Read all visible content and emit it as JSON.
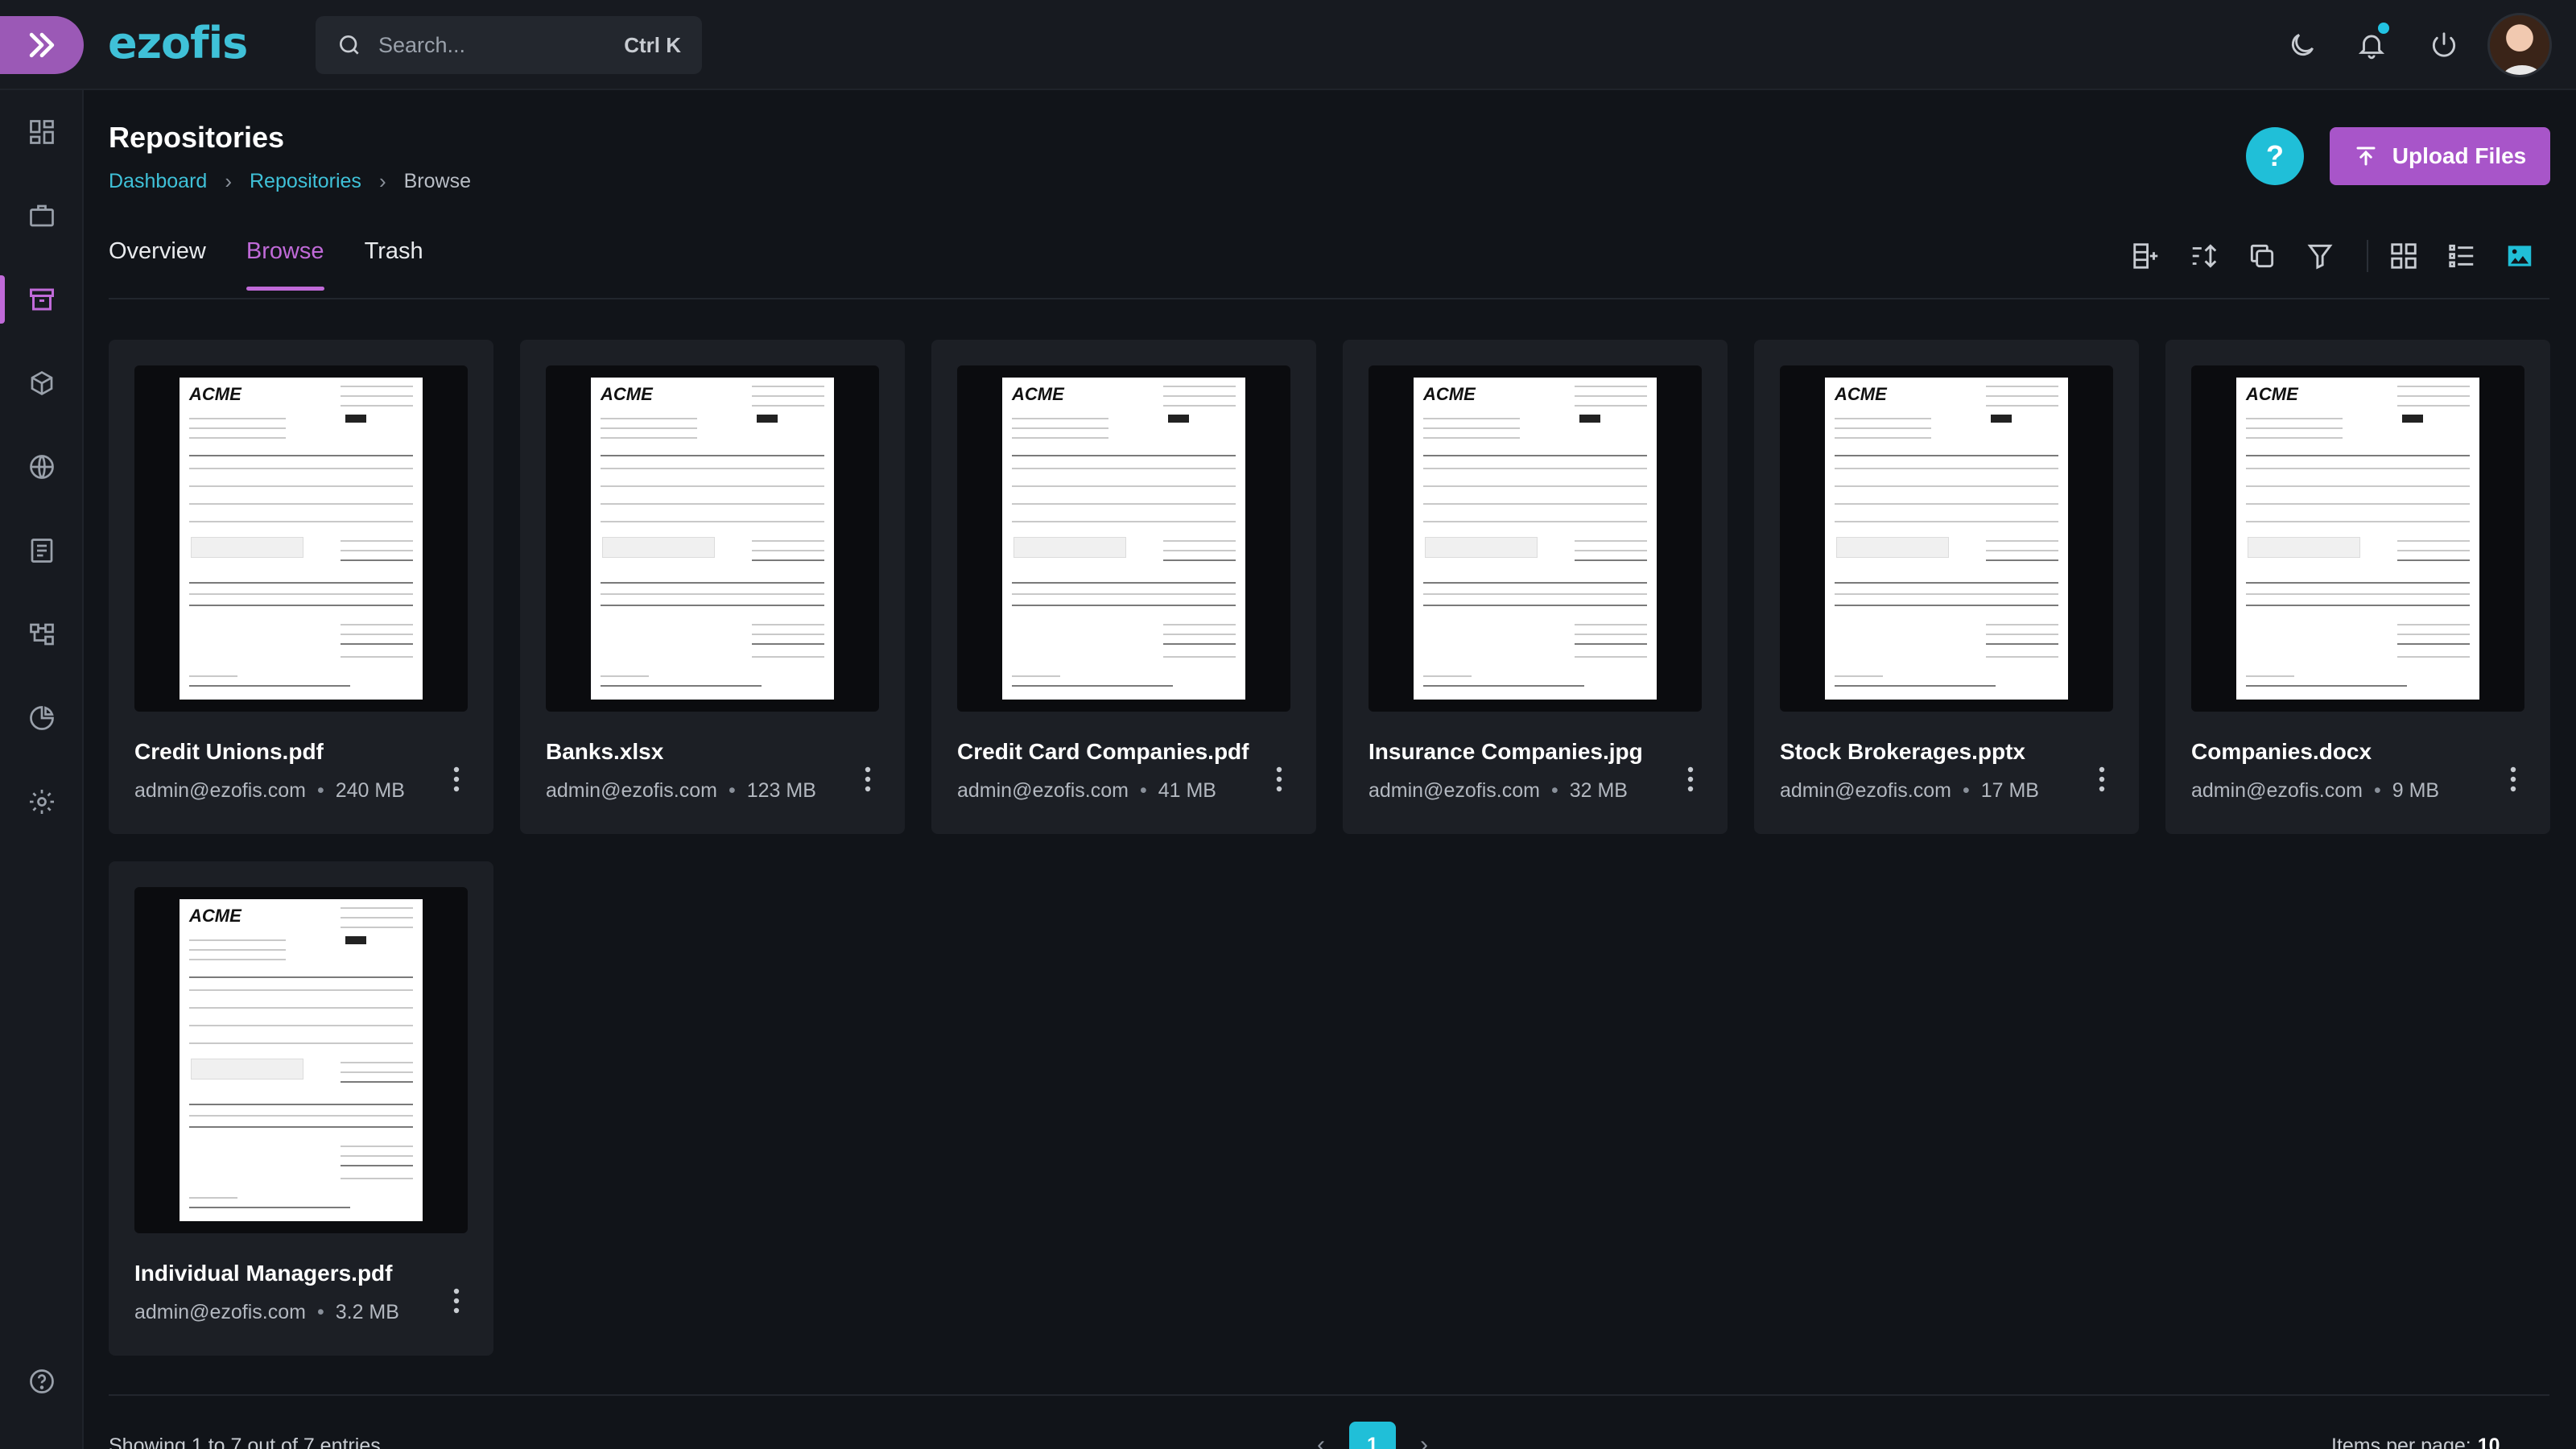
{
  "app": {
    "logo": "ezofis"
  },
  "search": {
    "placeholder": "Search...",
    "shortcut": "Ctrl K"
  },
  "header": {
    "title": "Repositories",
    "breadcrumb": [
      "Dashboard",
      "Repositories",
      "Browse"
    ],
    "help_label": "?",
    "upload_label": "Upload Files"
  },
  "tabs": [
    {
      "label": "Overview",
      "active": false
    },
    {
      "label": "Browse",
      "active": true
    },
    {
      "label": "Trash",
      "active": false
    }
  ],
  "sidebar": {
    "items": [
      {
        "icon": "dashboard-icon"
      },
      {
        "icon": "briefcase-icon"
      },
      {
        "icon": "archive-icon",
        "active": true
      },
      {
        "icon": "cube-icon"
      },
      {
        "icon": "globe-icon"
      },
      {
        "icon": "document-icon"
      },
      {
        "icon": "workflow-icon"
      },
      {
        "icon": "pie-chart-icon"
      },
      {
        "icon": "gear-icon"
      }
    ],
    "help_icon": "help-circle-icon"
  },
  "toolbar": [
    "add-column-icon",
    "sort-icon",
    "copy-icon",
    "filter-icon",
    "grid-view-icon",
    "list-view-icon",
    "image-view-icon"
  ],
  "files": [
    {
      "name": "Credit Unions.pdf",
      "owner": "admin@ezofis.com",
      "size": "240 MB"
    },
    {
      "name": "Banks.xlsx",
      "owner": "admin@ezofis.com",
      "size": "123 MB"
    },
    {
      "name": "Credit Card Companies.pdf",
      "owner": "admin@ezofis.com",
      "size": "41 MB"
    },
    {
      "name": "Insurance Companies.jpg",
      "owner": "admin@ezofis.com",
      "size": "32 MB"
    },
    {
      "name": "Stock Brokerages.pptx",
      "owner": "admin@ezofis.com",
      "size": "17 MB"
    },
    {
      "name": "Companies.docx",
      "owner": "admin@ezofis.com",
      "size": "9 MB"
    },
    {
      "name": "Individual Managers.pdf",
      "owner": "admin@ezofis.com",
      "size": "3.2 MB"
    }
  ],
  "thumbnail_brand": "ACME",
  "pagination": {
    "showing": "Showing 1 to 7 out of 7 entries",
    "current_page": "1",
    "items_per_page_label": "Items per page:",
    "items_per_page_value": "10"
  },
  "colors": {
    "accent_purple": "#a855c9",
    "accent_cyan": "#20bfd8",
    "background": "#111419"
  }
}
